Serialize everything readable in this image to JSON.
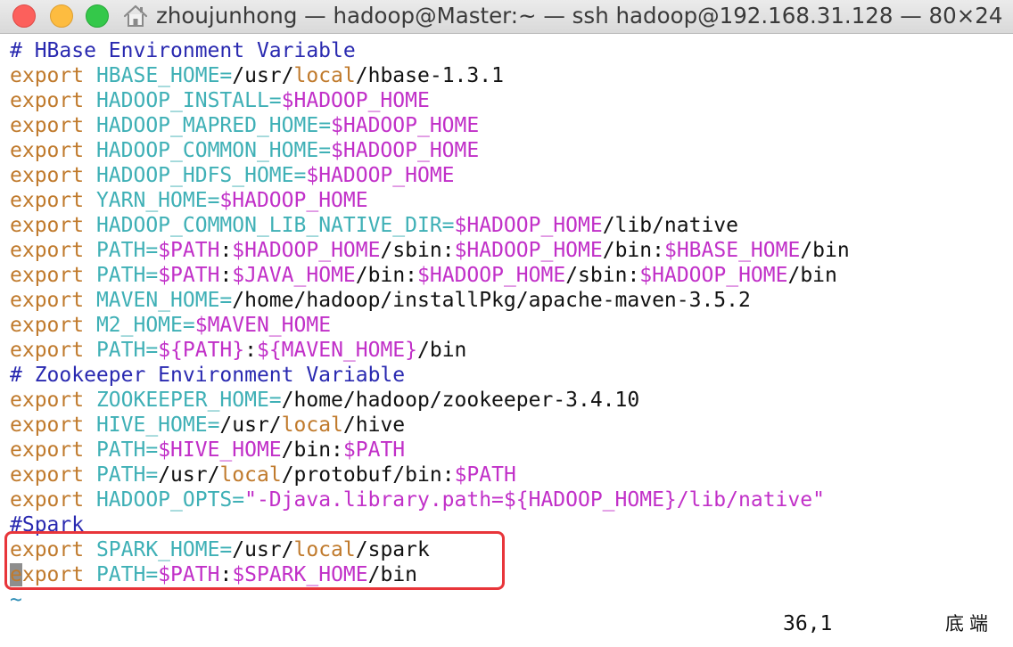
{
  "window": {
    "title": "zhoujunhong — hadoop@Master:~ — ssh hadoop@192.168.31.128 — 80×24"
  },
  "icons": {
    "close": "close-button",
    "minimize": "minimize-button",
    "maximize": "zoom-button",
    "home": "home-icon"
  },
  "colors": {
    "comment": "#2929b0",
    "keyword": "#c07a2c",
    "variable": "#3fb0b6",
    "reference": "#c130c8",
    "plain": "#111111",
    "highlight_border": "#e8353a"
  },
  "lines": [
    [
      {
        "t": "# HBase Environment Variable",
        "c": "comment"
      }
    ],
    [
      {
        "t": "export",
        "c": "kw"
      },
      {
        "t": " HBASE_HOME=",
        "c": "var"
      },
      {
        "t": "/usr/",
        "c": "plain"
      },
      {
        "t": "local",
        "c": "local"
      },
      {
        "t": "/hbase-1.3.1",
        "c": "plain"
      }
    ],
    [
      {
        "t": "export",
        "c": "kw"
      },
      {
        "t": " HADOOP_INSTALL=",
        "c": "var"
      },
      {
        "t": "$HADOOP_HOME",
        "c": "ref"
      }
    ],
    [
      {
        "t": "export",
        "c": "kw"
      },
      {
        "t": " HADOOP_MAPRED_HOME=",
        "c": "var"
      },
      {
        "t": "$HADOOP_HOME",
        "c": "ref"
      }
    ],
    [
      {
        "t": "export",
        "c": "kw"
      },
      {
        "t": " HADOOP_COMMON_HOME=",
        "c": "var"
      },
      {
        "t": "$HADOOP_HOME",
        "c": "ref"
      }
    ],
    [
      {
        "t": "export",
        "c": "kw"
      },
      {
        "t": " HADOOP_HDFS_HOME=",
        "c": "var"
      },
      {
        "t": "$HADOOP_HOME",
        "c": "ref"
      }
    ],
    [
      {
        "t": "export",
        "c": "kw"
      },
      {
        "t": " YARN_HOME=",
        "c": "var"
      },
      {
        "t": "$HADOOP_HOME",
        "c": "ref"
      }
    ],
    [
      {
        "t": "export",
        "c": "kw"
      },
      {
        "t": " HADOOP_COMMON_LIB_NATIVE_DIR=",
        "c": "var"
      },
      {
        "t": "$HADOOP_HOME",
        "c": "ref"
      },
      {
        "t": "/lib/native",
        "c": "plain"
      }
    ],
    [
      {
        "t": "export",
        "c": "kw"
      },
      {
        "t": " PATH=",
        "c": "var"
      },
      {
        "t": "$PATH",
        "c": "ref"
      },
      {
        "t": ":",
        "c": "plain"
      },
      {
        "t": "$HADOOP_HOME",
        "c": "ref"
      },
      {
        "t": "/sbin:",
        "c": "plain"
      },
      {
        "t": "$HADOOP_HOME",
        "c": "ref"
      },
      {
        "t": "/bin:",
        "c": "plain"
      },
      {
        "t": "$HBASE_HOME",
        "c": "ref"
      },
      {
        "t": "/bin",
        "c": "plain"
      }
    ],
    [
      {
        "t": "export",
        "c": "kw"
      },
      {
        "t": " PATH=",
        "c": "var"
      },
      {
        "t": "$PATH",
        "c": "ref"
      },
      {
        "t": ":",
        "c": "plain"
      },
      {
        "t": "$JAVA_HOME",
        "c": "ref"
      },
      {
        "t": "/bin:",
        "c": "plain"
      },
      {
        "t": "$HADOOP_HOME",
        "c": "ref"
      },
      {
        "t": "/sbin:",
        "c": "plain"
      },
      {
        "t": "$HADOOP_HOME",
        "c": "ref"
      },
      {
        "t": "/bin",
        "c": "plain"
      }
    ],
    [
      {
        "t": "export",
        "c": "kw"
      },
      {
        "t": " MAVEN_HOME=",
        "c": "var"
      },
      {
        "t": "/home/hadoop/installPkg/apache-maven-3.5.2",
        "c": "plain"
      }
    ],
    [
      {
        "t": "export",
        "c": "kw"
      },
      {
        "t": " M2_HOME=",
        "c": "var"
      },
      {
        "t": "$MAVEN_HOME",
        "c": "ref"
      }
    ],
    [
      {
        "t": "export",
        "c": "kw"
      },
      {
        "t": " PATH=",
        "c": "var"
      },
      {
        "t": "${PATH}",
        "c": "ref"
      },
      {
        "t": ":",
        "c": "plain"
      },
      {
        "t": "${MAVEN_HOME}",
        "c": "ref"
      },
      {
        "t": "/bin",
        "c": "plain"
      }
    ],
    [
      {
        "t": "# Zookeeper Environment Variable",
        "c": "comment"
      }
    ],
    [
      {
        "t": "export",
        "c": "kw"
      },
      {
        "t": " ZOOKEEPER_HOME=",
        "c": "var"
      },
      {
        "t": "/home/hadoop/zookeeper-3.4.10",
        "c": "plain"
      }
    ],
    [
      {
        "t": "export",
        "c": "kw"
      },
      {
        "t": " HIVE_HOME=",
        "c": "var"
      },
      {
        "t": "/usr/",
        "c": "plain"
      },
      {
        "t": "local",
        "c": "local"
      },
      {
        "t": "/hive",
        "c": "plain"
      }
    ],
    [
      {
        "t": "export",
        "c": "kw"
      },
      {
        "t": " PATH=",
        "c": "var"
      },
      {
        "t": "$HIVE_HOME",
        "c": "ref"
      },
      {
        "t": "/bin:",
        "c": "plain"
      },
      {
        "t": "$PATH",
        "c": "ref"
      }
    ],
    [
      {
        "t": "export",
        "c": "kw"
      },
      {
        "t": " PATH=",
        "c": "var"
      },
      {
        "t": "/usr/",
        "c": "plain"
      },
      {
        "t": "local",
        "c": "local"
      },
      {
        "t": "/protobuf/bin:",
        "c": "plain"
      },
      {
        "t": "$PATH",
        "c": "ref"
      }
    ],
    [
      {
        "t": "export",
        "c": "kw"
      },
      {
        "t": " HADOOP_OPTS=",
        "c": "var"
      },
      {
        "t": "\"-Djava.library.path=${HADOOP_HOME}/lib/native\"",
        "c": "str"
      }
    ],
    [
      {
        "t": "#Spark",
        "c": "comment"
      }
    ],
    [
      {
        "t": "export",
        "c": "kw"
      },
      {
        "t": " SPARK_HOME=",
        "c": "var"
      },
      {
        "t": "/usr/",
        "c": "plain"
      },
      {
        "t": "local",
        "c": "local"
      },
      {
        "t": "/spark",
        "c": "plain"
      }
    ],
    [
      {
        "t": "e",
        "c": "cursor"
      },
      {
        "t": "xport",
        "c": "kw"
      },
      {
        "t": " PATH=",
        "c": "var"
      },
      {
        "t": "$PATH",
        "c": "ref"
      },
      {
        "t": ":",
        "c": "plain"
      },
      {
        "t": "$SPARK_HOME",
        "c": "ref"
      },
      {
        "t": "/bin",
        "c": "plain"
      }
    ],
    [
      {
        "t": "~",
        "c": "tilde"
      }
    ]
  ],
  "status": {
    "position": "36,1",
    "scroll": "底端"
  }
}
